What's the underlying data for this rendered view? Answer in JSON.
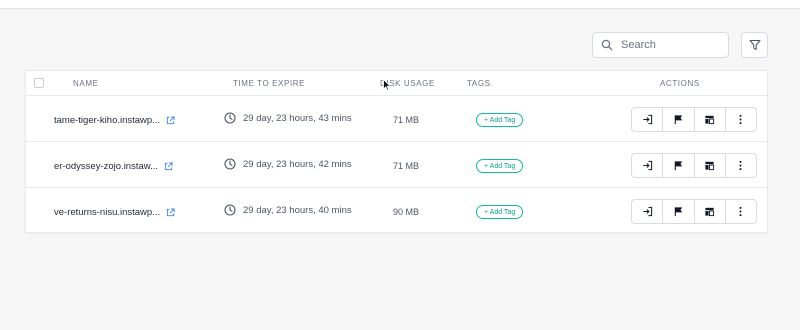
{
  "search": {
    "placeholder": "Search"
  },
  "table": {
    "columns": [
      "NAME",
      "TIME TO EXPIRE",
      "DISK USAGE",
      "TAGS",
      "ACTIONS"
    ],
    "rows": [
      {
        "name": "tame-tiger-kiho.instawp...",
        "expire": "29 day, 23 hours, 43 mins",
        "disk": "71 MB",
        "tag_label": "+ Add Tag"
      },
      {
        "name": "er-odyssey-zojo.instaw...",
        "expire": "29 day, 23 hours, 42 mins",
        "disk": "71 MB",
        "tag_label": "+ Add Tag"
      },
      {
        "name": "ve-returns-nisu.instawp...",
        "expire": "29 day, 23 hours, 40 mins",
        "disk": "90 MB",
        "tag_label": "+ Add Tag"
      }
    ]
  },
  "icons": {
    "search": "search-icon",
    "filter": "filter-icon",
    "external": "external-link-icon",
    "clock": "clock-icon",
    "login": "login-icon",
    "flag": "flag-icon",
    "layout": "layout-icon",
    "more": "more-vertical-icon"
  },
  "colors": {
    "accent": "#14b8a6",
    "link": "#3b82f6"
  }
}
